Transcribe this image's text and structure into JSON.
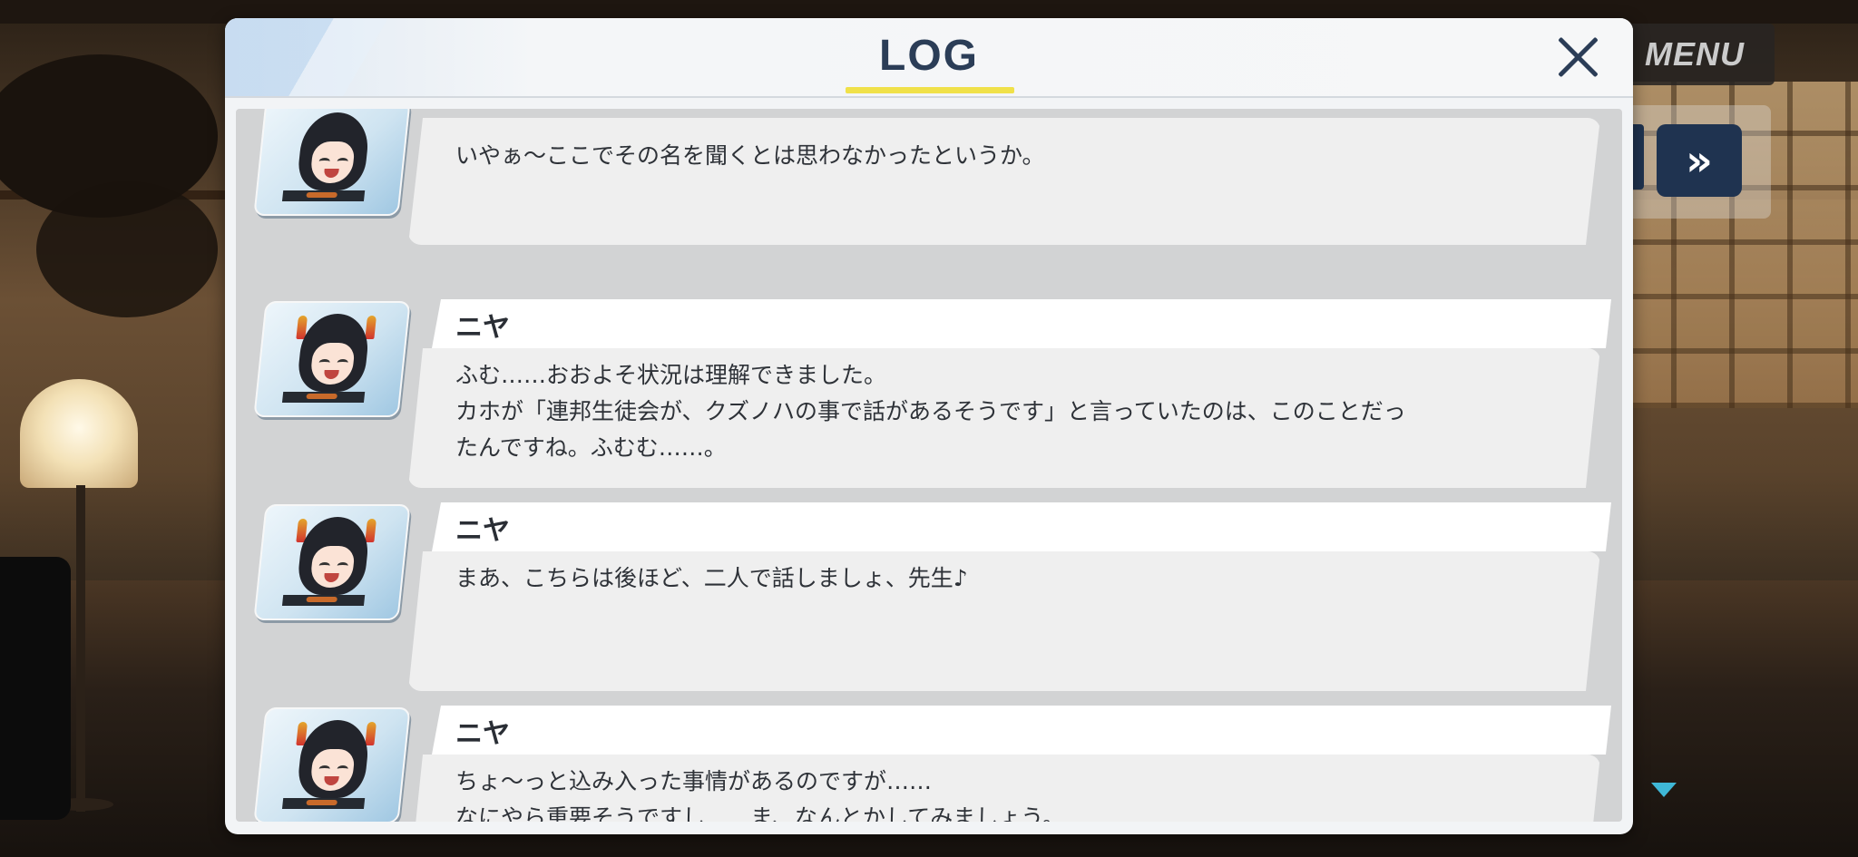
{
  "hud": {
    "menu_label": "MENU",
    "fast_forward_symbol": "»"
  },
  "log_dialog": {
    "title": "LOG",
    "close_symbol": "×"
  },
  "entries": [
    {
      "speaker": "",
      "text": "いやぁ～ここでその名を聞くとは思わなかったというか。"
    },
    {
      "speaker": "ニヤ",
      "text": "ふむ……おおよそ状況は理解できました。\nカホが「連邦生徒会が、クズノハの事で話があるそうです」と言っていたのは、このことだっ\nたんですね。ふむむ……。"
    },
    {
      "speaker": "ニヤ",
      "text": "まあ、こちらは後ほど、二人で話しましょ、先生♪"
    },
    {
      "speaker": "ニヤ",
      "text": "ちょ～っと込み入った事情があるのですが……\nなにやら重要そうですし……ま、なんとかしてみましょう。"
    }
  ],
  "colors": {
    "title": "#2b3d57",
    "underline": "#f0e14a",
    "button": "#1f3350",
    "indicator": "#3fb7d6"
  }
}
